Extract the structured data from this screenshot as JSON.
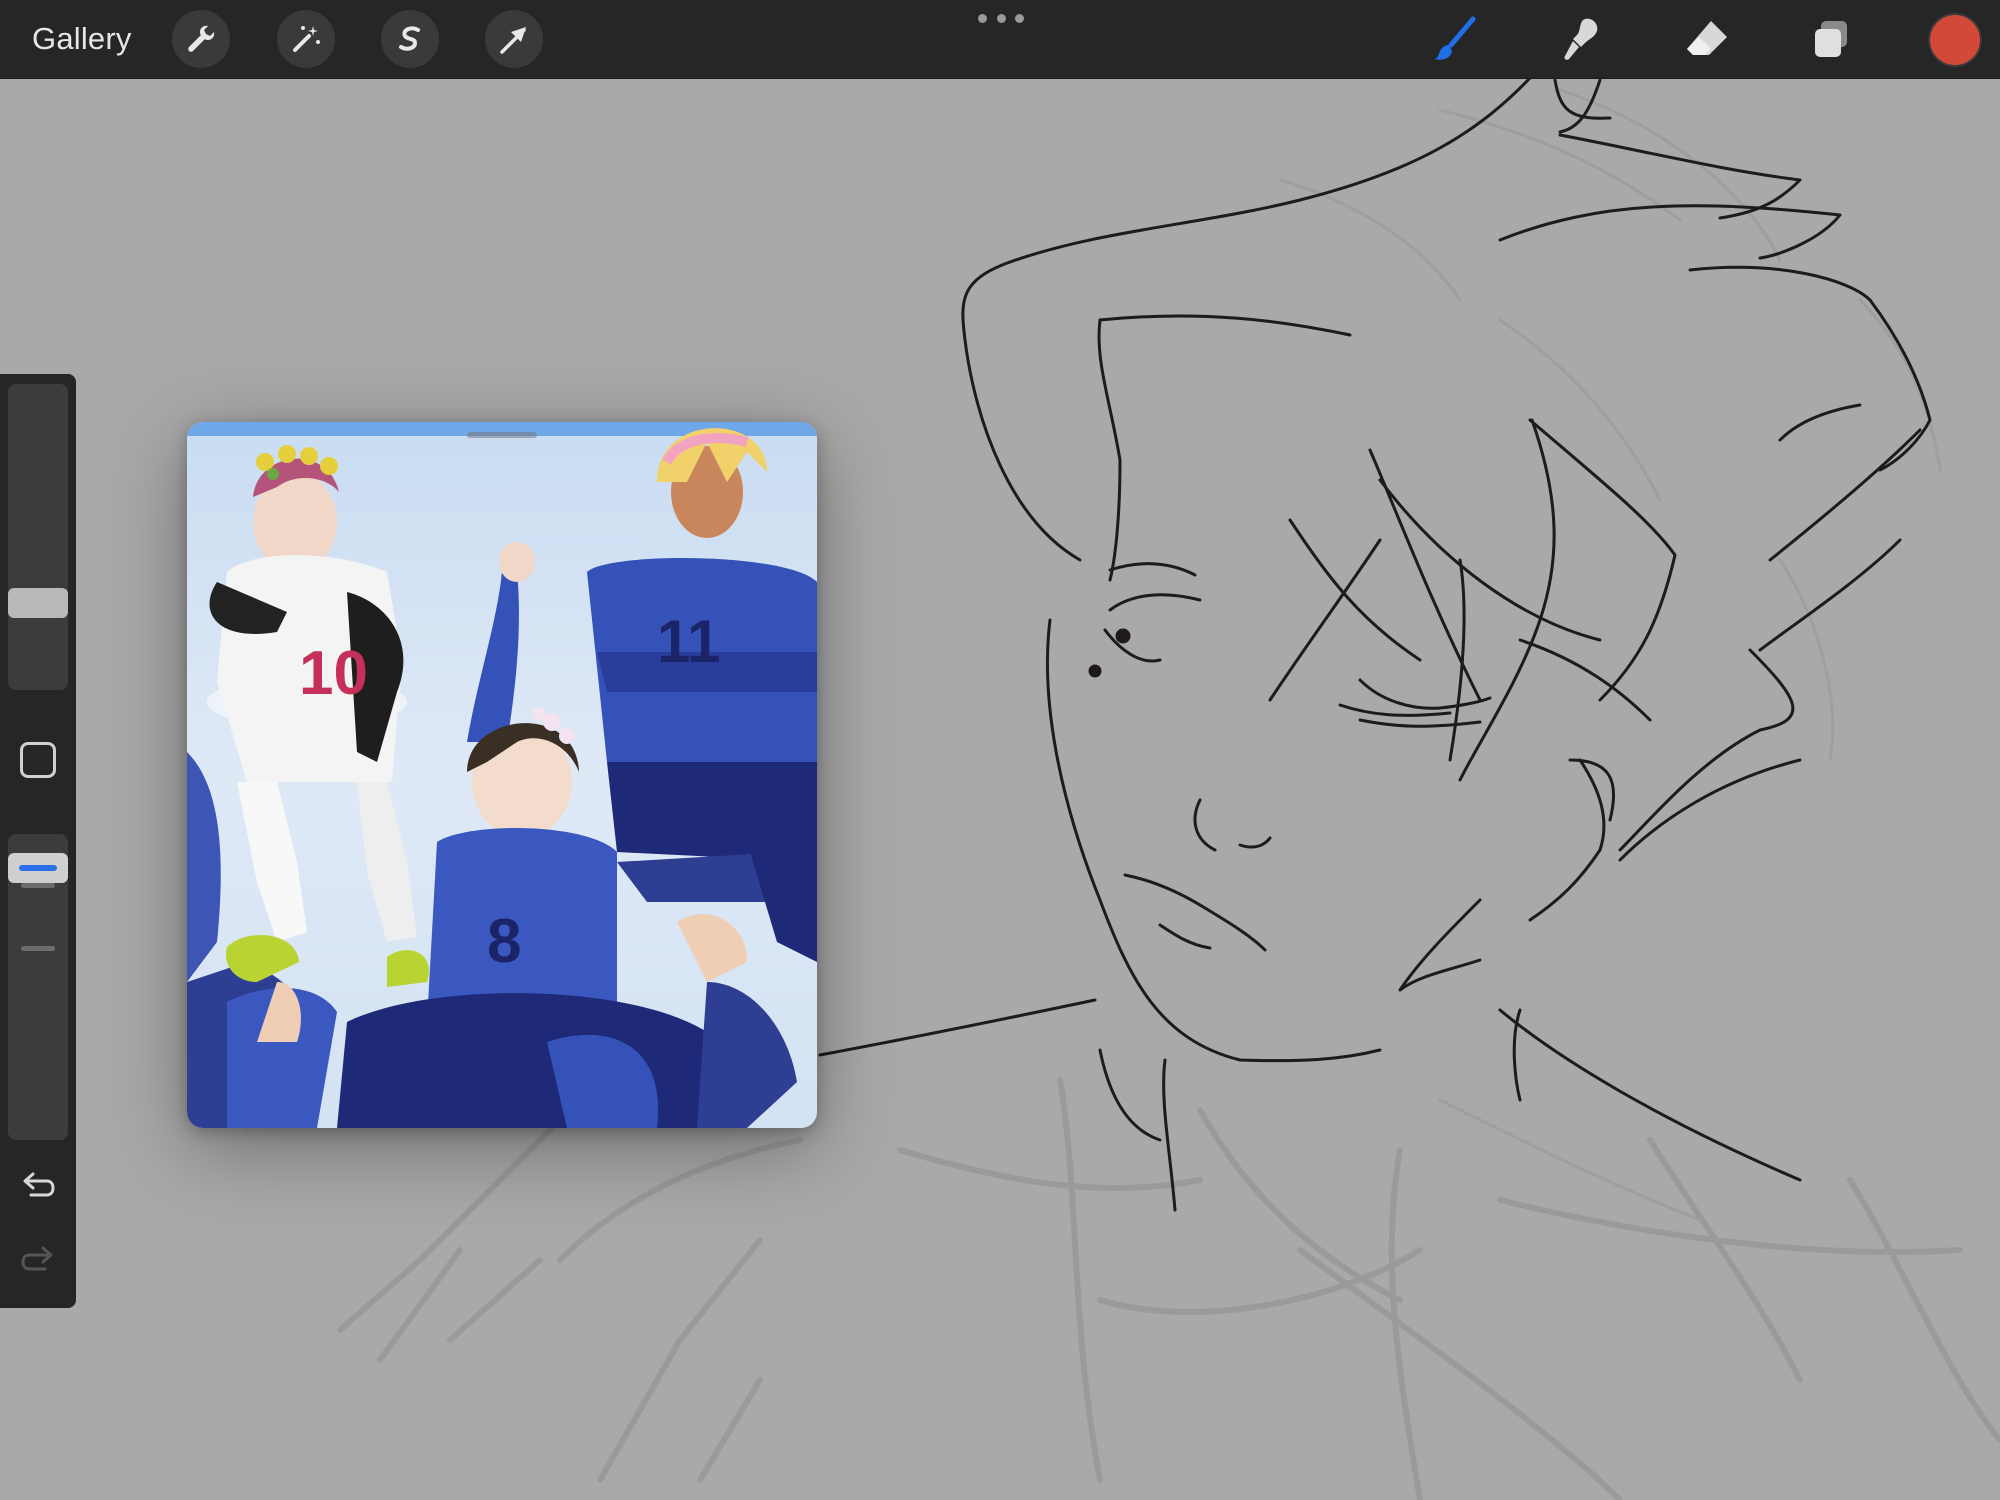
{
  "topbar": {
    "gallery_label": "Gallery",
    "left_tools": [
      "wrench-icon",
      "magic-wand-icon",
      "selection-s-icon",
      "transform-arrow-icon"
    ],
    "right_tools": [
      "brush-icon",
      "smudge-icon",
      "eraser-icon",
      "layers-icon"
    ],
    "active_tool": "brush-icon",
    "current_color": "#d24a37",
    "accent_color": "#1f6fe8"
  },
  "sidebar": {
    "brush_size": 0.25,
    "opacity": 0.95,
    "controls": [
      "modify-square-icon",
      "undo-icon",
      "redo-icon"
    ]
  },
  "reference": {
    "jersey_numbers": [
      "10",
      "11",
      "8"
    ]
  }
}
